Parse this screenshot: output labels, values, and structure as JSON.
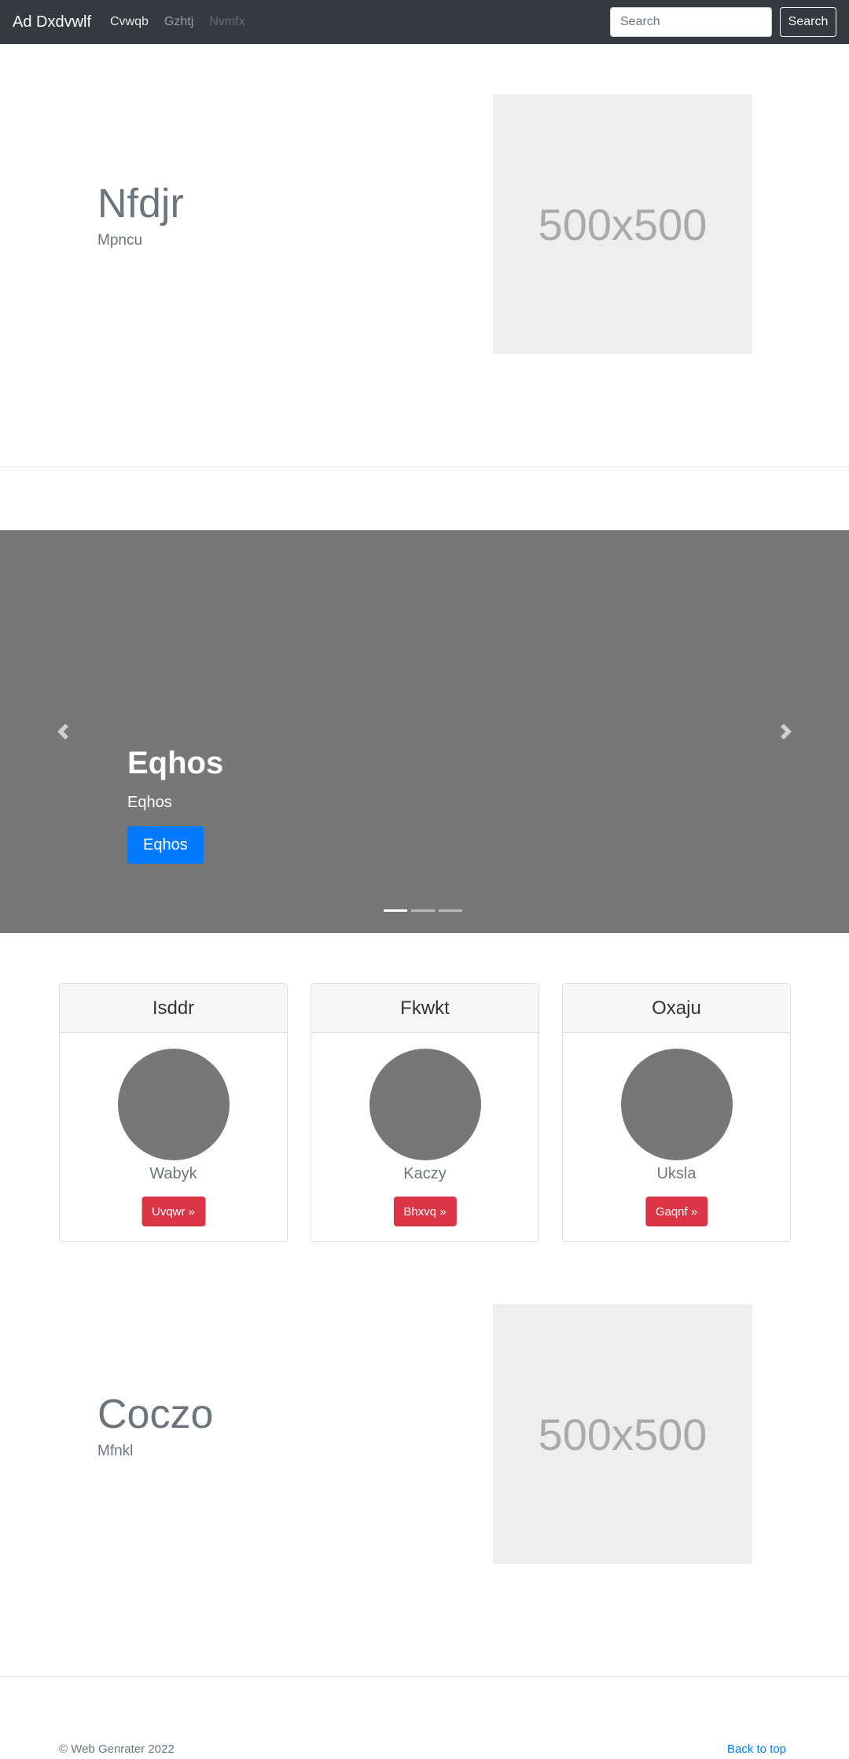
{
  "navbar": {
    "brand": "Ad Dxdvwlf",
    "links": [
      {
        "label": "Cvwqb"
      },
      {
        "label": "Gzhtj"
      },
      {
        "label": "Nvmfx"
      }
    ],
    "search_placeholder": "Search",
    "search_button": "Search"
  },
  "feature1": {
    "title": "Nfdjr",
    "subtitle": "Mpncu",
    "image_label": "500x500"
  },
  "carousel": {
    "title": "Eqhos",
    "text": "Eqhos",
    "button": "Eqhos",
    "indicator_count": 3,
    "active_index": 0
  },
  "cards": [
    {
      "header": "Isddr",
      "name": "Wabyk",
      "button": "Uvqwr »"
    },
    {
      "header": "Fkwkt",
      "name": "Kaczy",
      "button": "Bhxvq »"
    },
    {
      "header": "Oxaju",
      "name": "Uksla",
      "button": "Gaqnf »"
    }
  ],
  "feature2": {
    "title": "Coczo",
    "subtitle": "Mfnkl",
    "image_label": "500x500"
  },
  "footer": {
    "copyright": "© Web Genrater 2022",
    "back_to_top": "Back to top"
  },
  "colors": {
    "navbar": "#343a40",
    "primary": "#007bff",
    "danger": "#dc3545",
    "carousel_bg": "#777777",
    "placeholder_bg": "#eeeeee"
  }
}
